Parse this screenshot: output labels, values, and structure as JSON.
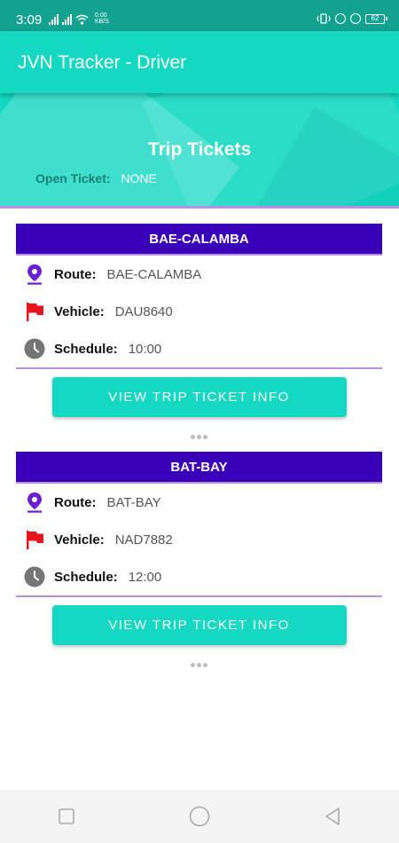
{
  "status_bar": {
    "time": "3:09",
    "net_speed_value": "0.00",
    "net_speed_unit": "KB/S",
    "battery": "62"
  },
  "app_bar": {
    "title": "JVN Tracker - Driver"
  },
  "banner": {
    "title": "Trip Tickets",
    "open_ticket_label": "Open Ticket:",
    "open_ticket_value": "NONE"
  },
  "tickets": [
    {
      "header": "BAE-CALAMBA",
      "route_label": "Route:",
      "route": "BAE-CALAMBA",
      "vehicle_label": "Vehicle:",
      "vehicle": "DAU8640",
      "schedule_label": "Schedule:",
      "schedule": "10:00",
      "button": "VIEW TRIP TICKET INFO"
    },
    {
      "header": "BAT-BAY",
      "route_label": "Route:",
      "route": "BAT-BAY",
      "vehicle_label": "Vehicle:",
      "vehicle": "NAD7882",
      "schedule_label": "Schedule:",
      "schedule": "12:00",
      "button": "VIEW TRIP TICKET INFO"
    }
  ],
  "icons": {
    "route": "location-pin-icon",
    "vehicle": "flag-icon",
    "schedule": "clock-icon"
  },
  "colors": {
    "accent": "#14d8c1",
    "header_purple": "#3a00b8",
    "divider": "#b890e8",
    "pin": "#6a1fd1",
    "flag": "#e8141b",
    "clock": "#757575"
  }
}
